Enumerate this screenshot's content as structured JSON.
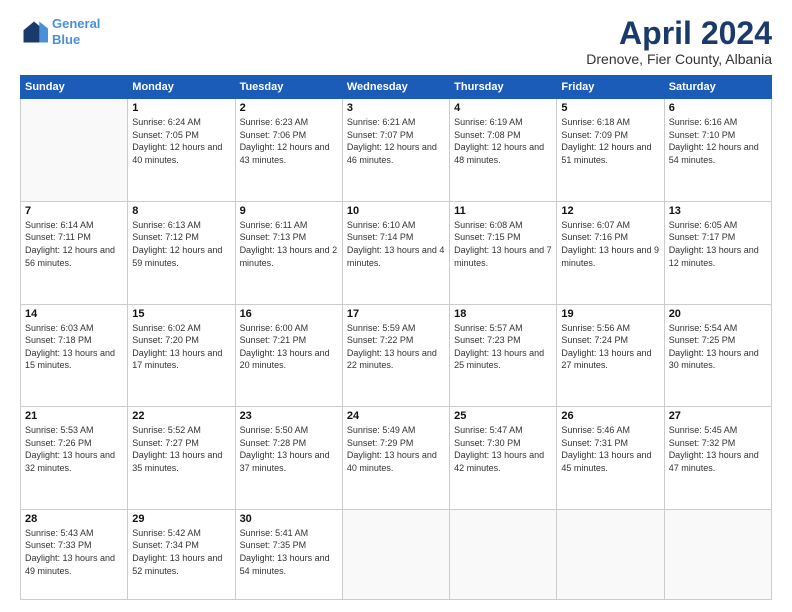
{
  "header": {
    "logo_line1": "General",
    "logo_line2": "Blue",
    "month": "April 2024",
    "location": "Drenove, Fier County, Albania"
  },
  "weekdays": [
    "Sunday",
    "Monday",
    "Tuesday",
    "Wednesday",
    "Thursday",
    "Friday",
    "Saturday"
  ],
  "weeks": [
    [
      {
        "day": "",
        "sunrise": "",
        "sunset": "",
        "daylight": ""
      },
      {
        "day": "1",
        "sunrise": "Sunrise: 6:24 AM",
        "sunset": "Sunset: 7:05 PM",
        "daylight": "Daylight: 12 hours and 40 minutes."
      },
      {
        "day": "2",
        "sunrise": "Sunrise: 6:23 AM",
        "sunset": "Sunset: 7:06 PM",
        "daylight": "Daylight: 12 hours and 43 minutes."
      },
      {
        "day": "3",
        "sunrise": "Sunrise: 6:21 AM",
        "sunset": "Sunset: 7:07 PM",
        "daylight": "Daylight: 12 hours and 46 minutes."
      },
      {
        "day": "4",
        "sunrise": "Sunrise: 6:19 AM",
        "sunset": "Sunset: 7:08 PM",
        "daylight": "Daylight: 12 hours and 48 minutes."
      },
      {
        "day": "5",
        "sunrise": "Sunrise: 6:18 AM",
        "sunset": "Sunset: 7:09 PM",
        "daylight": "Daylight: 12 hours and 51 minutes."
      },
      {
        "day": "6",
        "sunrise": "Sunrise: 6:16 AM",
        "sunset": "Sunset: 7:10 PM",
        "daylight": "Daylight: 12 hours and 54 minutes."
      }
    ],
    [
      {
        "day": "7",
        "sunrise": "Sunrise: 6:14 AM",
        "sunset": "Sunset: 7:11 PM",
        "daylight": "Daylight: 12 hours and 56 minutes."
      },
      {
        "day": "8",
        "sunrise": "Sunrise: 6:13 AM",
        "sunset": "Sunset: 7:12 PM",
        "daylight": "Daylight: 12 hours and 59 minutes."
      },
      {
        "day": "9",
        "sunrise": "Sunrise: 6:11 AM",
        "sunset": "Sunset: 7:13 PM",
        "daylight": "Daylight: 13 hours and 2 minutes."
      },
      {
        "day": "10",
        "sunrise": "Sunrise: 6:10 AM",
        "sunset": "Sunset: 7:14 PM",
        "daylight": "Daylight: 13 hours and 4 minutes."
      },
      {
        "day": "11",
        "sunrise": "Sunrise: 6:08 AM",
        "sunset": "Sunset: 7:15 PM",
        "daylight": "Daylight: 13 hours and 7 minutes."
      },
      {
        "day": "12",
        "sunrise": "Sunrise: 6:07 AM",
        "sunset": "Sunset: 7:16 PM",
        "daylight": "Daylight: 13 hours and 9 minutes."
      },
      {
        "day": "13",
        "sunrise": "Sunrise: 6:05 AM",
        "sunset": "Sunset: 7:17 PM",
        "daylight": "Daylight: 13 hours and 12 minutes."
      }
    ],
    [
      {
        "day": "14",
        "sunrise": "Sunrise: 6:03 AM",
        "sunset": "Sunset: 7:18 PM",
        "daylight": "Daylight: 13 hours and 15 minutes."
      },
      {
        "day": "15",
        "sunrise": "Sunrise: 6:02 AM",
        "sunset": "Sunset: 7:20 PM",
        "daylight": "Daylight: 13 hours and 17 minutes."
      },
      {
        "day": "16",
        "sunrise": "Sunrise: 6:00 AM",
        "sunset": "Sunset: 7:21 PM",
        "daylight": "Daylight: 13 hours and 20 minutes."
      },
      {
        "day": "17",
        "sunrise": "Sunrise: 5:59 AM",
        "sunset": "Sunset: 7:22 PM",
        "daylight": "Daylight: 13 hours and 22 minutes."
      },
      {
        "day": "18",
        "sunrise": "Sunrise: 5:57 AM",
        "sunset": "Sunset: 7:23 PM",
        "daylight": "Daylight: 13 hours and 25 minutes."
      },
      {
        "day": "19",
        "sunrise": "Sunrise: 5:56 AM",
        "sunset": "Sunset: 7:24 PM",
        "daylight": "Daylight: 13 hours and 27 minutes."
      },
      {
        "day": "20",
        "sunrise": "Sunrise: 5:54 AM",
        "sunset": "Sunset: 7:25 PM",
        "daylight": "Daylight: 13 hours and 30 minutes."
      }
    ],
    [
      {
        "day": "21",
        "sunrise": "Sunrise: 5:53 AM",
        "sunset": "Sunset: 7:26 PM",
        "daylight": "Daylight: 13 hours and 32 minutes."
      },
      {
        "day": "22",
        "sunrise": "Sunrise: 5:52 AM",
        "sunset": "Sunset: 7:27 PM",
        "daylight": "Daylight: 13 hours and 35 minutes."
      },
      {
        "day": "23",
        "sunrise": "Sunrise: 5:50 AM",
        "sunset": "Sunset: 7:28 PM",
        "daylight": "Daylight: 13 hours and 37 minutes."
      },
      {
        "day": "24",
        "sunrise": "Sunrise: 5:49 AM",
        "sunset": "Sunset: 7:29 PM",
        "daylight": "Daylight: 13 hours and 40 minutes."
      },
      {
        "day": "25",
        "sunrise": "Sunrise: 5:47 AM",
        "sunset": "Sunset: 7:30 PM",
        "daylight": "Daylight: 13 hours and 42 minutes."
      },
      {
        "day": "26",
        "sunrise": "Sunrise: 5:46 AM",
        "sunset": "Sunset: 7:31 PM",
        "daylight": "Daylight: 13 hours and 45 minutes."
      },
      {
        "day": "27",
        "sunrise": "Sunrise: 5:45 AM",
        "sunset": "Sunset: 7:32 PM",
        "daylight": "Daylight: 13 hours and 47 minutes."
      }
    ],
    [
      {
        "day": "28",
        "sunrise": "Sunrise: 5:43 AM",
        "sunset": "Sunset: 7:33 PM",
        "daylight": "Daylight: 13 hours and 49 minutes."
      },
      {
        "day": "29",
        "sunrise": "Sunrise: 5:42 AM",
        "sunset": "Sunset: 7:34 PM",
        "daylight": "Daylight: 13 hours and 52 minutes."
      },
      {
        "day": "30",
        "sunrise": "Sunrise: 5:41 AM",
        "sunset": "Sunset: 7:35 PM",
        "daylight": "Daylight: 13 hours and 54 minutes."
      },
      {
        "day": "",
        "sunrise": "",
        "sunset": "",
        "daylight": ""
      },
      {
        "day": "",
        "sunrise": "",
        "sunset": "",
        "daylight": ""
      },
      {
        "day": "",
        "sunrise": "",
        "sunset": "",
        "daylight": ""
      },
      {
        "day": "",
        "sunrise": "",
        "sunset": "",
        "daylight": ""
      }
    ]
  ]
}
